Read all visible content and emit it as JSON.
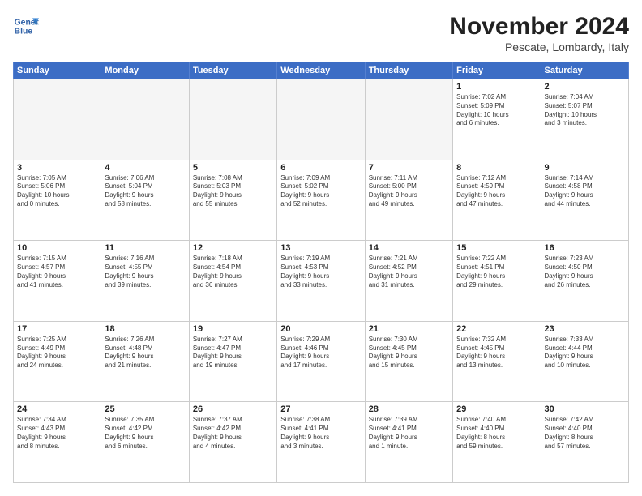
{
  "header": {
    "logo_line1": "General",
    "logo_line2": "Blue",
    "month_title": "November 2024",
    "location": "Pescate, Lombardy, Italy"
  },
  "weekdays": [
    "Sunday",
    "Monday",
    "Tuesday",
    "Wednesday",
    "Thursday",
    "Friday",
    "Saturday"
  ],
  "weeks": [
    [
      {
        "day": "",
        "info": ""
      },
      {
        "day": "",
        "info": ""
      },
      {
        "day": "",
        "info": ""
      },
      {
        "day": "",
        "info": ""
      },
      {
        "day": "",
        "info": ""
      },
      {
        "day": "1",
        "info": "Sunrise: 7:02 AM\nSunset: 5:09 PM\nDaylight: 10 hours\nand 6 minutes."
      },
      {
        "day": "2",
        "info": "Sunrise: 7:04 AM\nSunset: 5:07 PM\nDaylight: 10 hours\nand 3 minutes."
      }
    ],
    [
      {
        "day": "3",
        "info": "Sunrise: 7:05 AM\nSunset: 5:06 PM\nDaylight: 10 hours\nand 0 minutes."
      },
      {
        "day": "4",
        "info": "Sunrise: 7:06 AM\nSunset: 5:04 PM\nDaylight: 9 hours\nand 58 minutes."
      },
      {
        "day": "5",
        "info": "Sunrise: 7:08 AM\nSunset: 5:03 PM\nDaylight: 9 hours\nand 55 minutes."
      },
      {
        "day": "6",
        "info": "Sunrise: 7:09 AM\nSunset: 5:02 PM\nDaylight: 9 hours\nand 52 minutes."
      },
      {
        "day": "7",
        "info": "Sunrise: 7:11 AM\nSunset: 5:00 PM\nDaylight: 9 hours\nand 49 minutes."
      },
      {
        "day": "8",
        "info": "Sunrise: 7:12 AM\nSunset: 4:59 PM\nDaylight: 9 hours\nand 47 minutes."
      },
      {
        "day": "9",
        "info": "Sunrise: 7:14 AM\nSunset: 4:58 PM\nDaylight: 9 hours\nand 44 minutes."
      }
    ],
    [
      {
        "day": "10",
        "info": "Sunrise: 7:15 AM\nSunset: 4:57 PM\nDaylight: 9 hours\nand 41 minutes."
      },
      {
        "day": "11",
        "info": "Sunrise: 7:16 AM\nSunset: 4:55 PM\nDaylight: 9 hours\nand 39 minutes."
      },
      {
        "day": "12",
        "info": "Sunrise: 7:18 AM\nSunset: 4:54 PM\nDaylight: 9 hours\nand 36 minutes."
      },
      {
        "day": "13",
        "info": "Sunrise: 7:19 AM\nSunset: 4:53 PM\nDaylight: 9 hours\nand 33 minutes."
      },
      {
        "day": "14",
        "info": "Sunrise: 7:21 AM\nSunset: 4:52 PM\nDaylight: 9 hours\nand 31 minutes."
      },
      {
        "day": "15",
        "info": "Sunrise: 7:22 AM\nSunset: 4:51 PM\nDaylight: 9 hours\nand 29 minutes."
      },
      {
        "day": "16",
        "info": "Sunrise: 7:23 AM\nSunset: 4:50 PM\nDaylight: 9 hours\nand 26 minutes."
      }
    ],
    [
      {
        "day": "17",
        "info": "Sunrise: 7:25 AM\nSunset: 4:49 PM\nDaylight: 9 hours\nand 24 minutes."
      },
      {
        "day": "18",
        "info": "Sunrise: 7:26 AM\nSunset: 4:48 PM\nDaylight: 9 hours\nand 21 minutes."
      },
      {
        "day": "19",
        "info": "Sunrise: 7:27 AM\nSunset: 4:47 PM\nDaylight: 9 hours\nand 19 minutes."
      },
      {
        "day": "20",
        "info": "Sunrise: 7:29 AM\nSunset: 4:46 PM\nDaylight: 9 hours\nand 17 minutes."
      },
      {
        "day": "21",
        "info": "Sunrise: 7:30 AM\nSunset: 4:45 PM\nDaylight: 9 hours\nand 15 minutes."
      },
      {
        "day": "22",
        "info": "Sunrise: 7:32 AM\nSunset: 4:45 PM\nDaylight: 9 hours\nand 13 minutes."
      },
      {
        "day": "23",
        "info": "Sunrise: 7:33 AM\nSunset: 4:44 PM\nDaylight: 9 hours\nand 10 minutes."
      }
    ],
    [
      {
        "day": "24",
        "info": "Sunrise: 7:34 AM\nSunset: 4:43 PM\nDaylight: 9 hours\nand 8 minutes."
      },
      {
        "day": "25",
        "info": "Sunrise: 7:35 AM\nSunset: 4:42 PM\nDaylight: 9 hours\nand 6 minutes."
      },
      {
        "day": "26",
        "info": "Sunrise: 7:37 AM\nSunset: 4:42 PM\nDaylight: 9 hours\nand 4 minutes."
      },
      {
        "day": "27",
        "info": "Sunrise: 7:38 AM\nSunset: 4:41 PM\nDaylight: 9 hours\nand 3 minutes."
      },
      {
        "day": "28",
        "info": "Sunrise: 7:39 AM\nSunset: 4:41 PM\nDaylight: 9 hours\nand 1 minute."
      },
      {
        "day": "29",
        "info": "Sunrise: 7:40 AM\nSunset: 4:40 PM\nDaylight: 8 hours\nand 59 minutes."
      },
      {
        "day": "30",
        "info": "Sunrise: 7:42 AM\nSunset: 4:40 PM\nDaylight: 8 hours\nand 57 minutes."
      }
    ]
  ]
}
